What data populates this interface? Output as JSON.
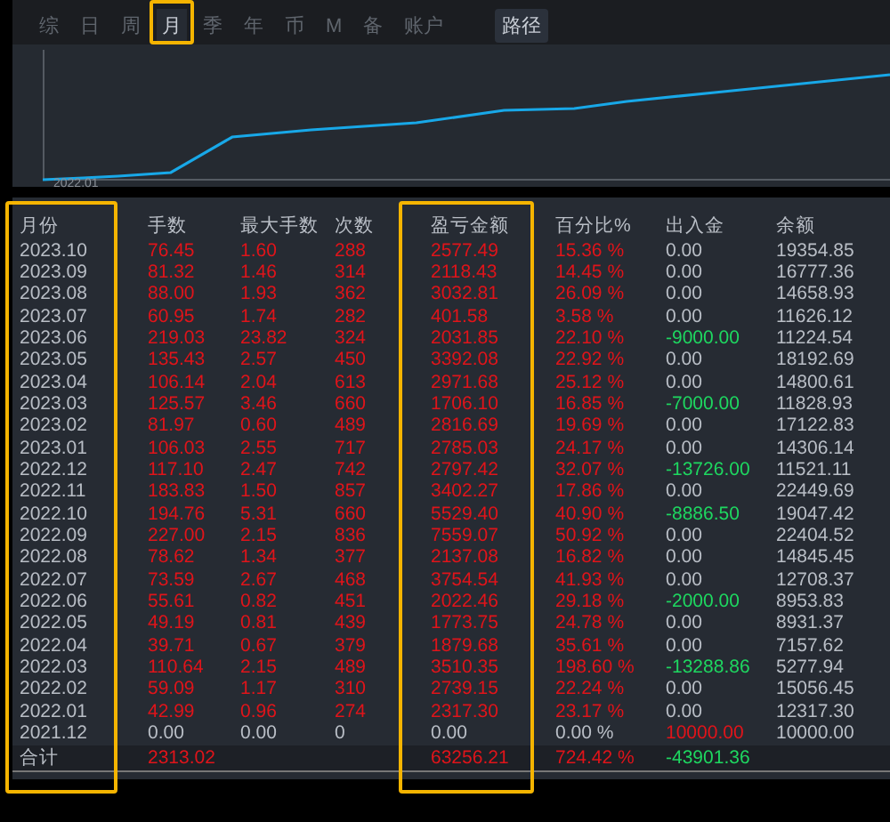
{
  "tabs": [
    {
      "label": "综",
      "selected": false
    },
    {
      "label": "日",
      "selected": false
    },
    {
      "label": "周",
      "selected": false
    },
    {
      "label": "月",
      "selected": true
    },
    {
      "label": "季",
      "selected": false
    },
    {
      "label": "年",
      "selected": false
    },
    {
      "label": "币",
      "selected": false
    },
    {
      "label": "M",
      "selected": false
    },
    {
      "label": "备",
      "selected": false
    },
    {
      "label": "账户",
      "selected": false
    }
  ],
  "path_button": "路径",
  "chart": {
    "start_label": "2022.01"
  },
  "table": {
    "columns": [
      "月份",
      "手数",
      "最大手数",
      "次数",
      "盈亏金额",
      "百分比%",
      "出入金",
      "余额"
    ],
    "rows": [
      {
        "kind": "trade",
        "withdrawal": false,
        "deposit": false,
        "cells": [
          "2023.10",
          "76.45",
          "1.60",
          "288",
          "2577.49",
          "15.36 %",
          "0.00",
          "19354.85"
        ]
      },
      {
        "kind": "trade",
        "withdrawal": false,
        "deposit": false,
        "cells": [
          "2023.09",
          "81.32",
          "1.46",
          "314",
          "2118.43",
          "14.45 %",
          "0.00",
          "16777.36"
        ]
      },
      {
        "kind": "trade",
        "withdrawal": false,
        "deposit": false,
        "cells": [
          "2023.08",
          "88.00",
          "1.93",
          "362",
          "3032.81",
          "26.09 %",
          "0.00",
          "14658.93"
        ]
      },
      {
        "kind": "trade",
        "withdrawal": false,
        "deposit": false,
        "cells": [
          "2023.07",
          "60.95",
          "1.74",
          "282",
          "401.58",
          "3.58 %",
          "0.00",
          "11626.12"
        ]
      },
      {
        "kind": "trade",
        "withdrawal": true,
        "deposit": false,
        "cells": [
          "2023.06",
          "219.03",
          "23.82",
          "324",
          "2031.85",
          "22.10 %",
          "-9000.00",
          "11224.54"
        ]
      },
      {
        "kind": "trade",
        "withdrawal": false,
        "deposit": false,
        "cells": [
          "2023.05",
          "135.43",
          "2.57",
          "450",
          "3392.08",
          "22.92 %",
          "0.00",
          "18192.69"
        ]
      },
      {
        "kind": "trade",
        "withdrawal": false,
        "deposit": false,
        "cells": [
          "2023.04",
          "106.14",
          "2.04",
          "613",
          "2971.68",
          "25.12 %",
          "0.00",
          "14800.61"
        ]
      },
      {
        "kind": "trade",
        "withdrawal": true,
        "deposit": false,
        "cells": [
          "2023.03",
          "125.57",
          "3.46",
          "660",
          "1706.10",
          "16.85 %",
          "-7000.00",
          "11828.93"
        ]
      },
      {
        "kind": "trade",
        "withdrawal": false,
        "deposit": false,
        "cells": [
          "2023.02",
          "81.97",
          "0.60",
          "489",
          "2816.69",
          "19.69 %",
          "0.00",
          "17122.83"
        ]
      },
      {
        "kind": "trade",
        "withdrawal": false,
        "deposit": false,
        "cells": [
          "2023.01",
          "106.03",
          "2.55",
          "717",
          "2785.03",
          "24.17 %",
          "0.00",
          "14306.14"
        ]
      },
      {
        "kind": "trade",
        "withdrawal": true,
        "deposit": false,
        "cells": [
          "2022.12",
          "117.10",
          "2.47",
          "742",
          "2797.42",
          "32.07 %",
          "-13726.00",
          "11521.11"
        ]
      },
      {
        "kind": "trade",
        "withdrawal": false,
        "deposit": false,
        "cells": [
          "2022.11",
          "183.83",
          "1.50",
          "857",
          "3402.27",
          "17.86 %",
          "0.00",
          "22449.69"
        ]
      },
      {
        "kind": "trade",
        "withdrawal": true,
        "deposit": false,
        "cells": [
          "2022.10",
          "194.76",
          "5.31",
          "660",
          "5529.40",
          "40.90 %",
          "-8886.50",
          "19047.42"
        ]
      },
      {
        "kind": "trade",
        "withdrawal": false,
        "deposit": false,
        "cells": [
          "2022.09",
          "227.00",
          "2.15",
          "836",
          "7559.07",
          "50.92 %",
          "0.00",
          "22404.52"
        ]
      },
      {
        "kind": "trade",
        "withdrawal": false,
        "deposit": false,
        "cells": [
          "2022.08",
          "78.62",
          "1.34",
          "377",
          "2137.08",
          "16.82 %",
          "0.00",
          "14845.45"
        ]
      },
      {
        "kind": "trade",
        "withdrawal": false,
        "deposit": false,
        "cells": [
          "2022.07",
          "73.59",
          "2.67",
          "468",
          "3754.54",
          "41.93 %",
          "0.00",
          "12708.37"
        ]
      },
      {
        "kind": "trade",
        "withdrawal": true,
        "deposit": false,
        "cells": [
          "2022.06",
          "55.61",
          "0.82",
          "451",
          "2022.46",
          "29.18 %",
          "-2000.00",
          "8953.83"
        ]
      },
      {
        "kind": "trade",
        "withdrawal": false,
        "deposit": false,
        "cells": [
          "2022.05",
          "49.19",
          "0.81",
          "439",
          "1773.75",
          "24.78 %",
          "0.00",
          "8931.37"
        ]
      },
      {
        "kind": "trade",
        "withdrawal": false,
        "deposit": false,
        "cells": [
          "2022.04",
          "39.71",
          "0.67",
          "379",
          "1879.68",
          "35.61 %",
          "0.00",
          "7157.62"
        ]
      },
      {
        "kind": "trade",
        "withdrawal": true,
        "deposit": false,
        "cells": [
          "2022.03",
          "110.64",
          "2.15",
          "489",
          "3510.35",
          "198.60 %",
          "-13288.86",
          "5277.94"
        ]
      },
      {
        "kind": "trade",
        "withdrawal": false,
        "deposit": false,
        "cells": [
          "2022.02",
          "59.09",
          "1.17",
          "310",
          "2739.15",
          "22.24 %",
          "0.00",
          "15056.45"
        ]
      },
      {
        "kind": "trade",
        "withdrawal": false,
        "deposit": false,
        "cells": [
          "2022.01",
          "42.99",
          "0.96",
          "274",
          "2317.30",
          "23.17 %",
          "0.00",
          "12317.30"
        ]
      },
      {
        "kind": "blank",
        "withdrawal": false,
        "deposit": true,
        "cells": [
          "2021.12",
          "0.00",
          "0.00",
          "0",
          "0.00",
          "0.00 %",
          "10000.00",
          "10000.00"
        ]
      }
    ],
    "total": {
      "label": "合计",
      "lots": "2313.02",
      "pnl": "63256.21",
      "percent": "724.42 %",
      "flow": "-43901.36"
    }
  }
}
